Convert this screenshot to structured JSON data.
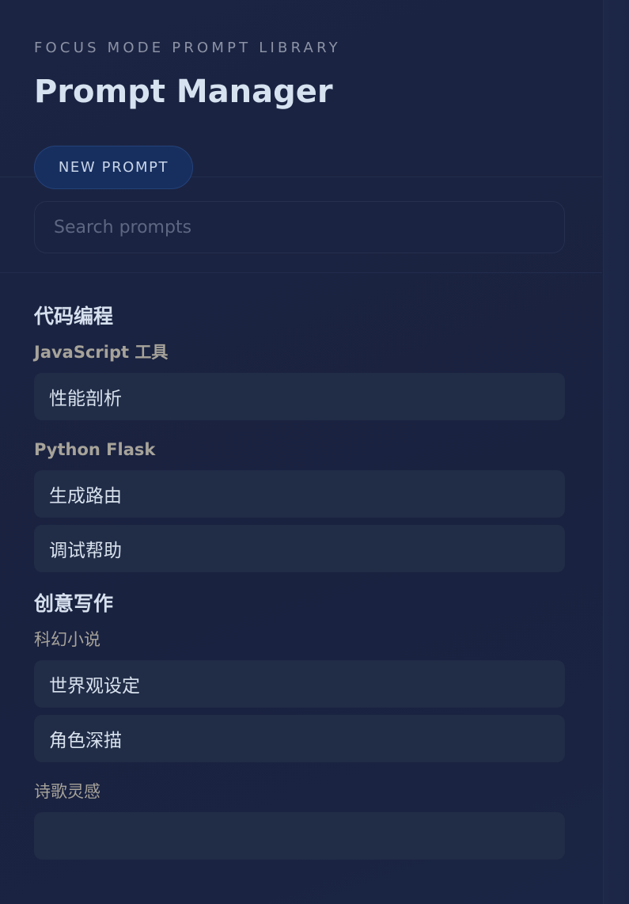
{
  "header": {
    "eyebrow": "FOCUS MODE PROMPT LIBRARY",
    "title": "Prompt Manager",
    "new_button": "NEW PROMPT"
  },
  "search": {
    "placeholder": "Search prompts",
    "value": ""
  },
  "categories": [
    {
      "title": "代码编程",
      "groups": [
        {
          "title": "JavaScript 工具",
          "items": [
            "性能剖析"
          ]
        },
        {
          "title": "Python Flask",
          "items": [
            "生成路由",
            "调试帮助"
          ]
        }
      ]
    },
    {
      "title": "创意写作",
      "groups": [
        {
          "title": "科幻小说",
          "items": [
            "世界观设定",
            "角色深描"
          ]
        },
        {
          "title": "诗歌灵感",
          "items": [
            ""
          ]
        }
      ]
    }
  ],
  "colors": {
    "background": "#1a2340",
    "accent_button": "#172f5f",
    "item_background": "#212c47"
  }
}
